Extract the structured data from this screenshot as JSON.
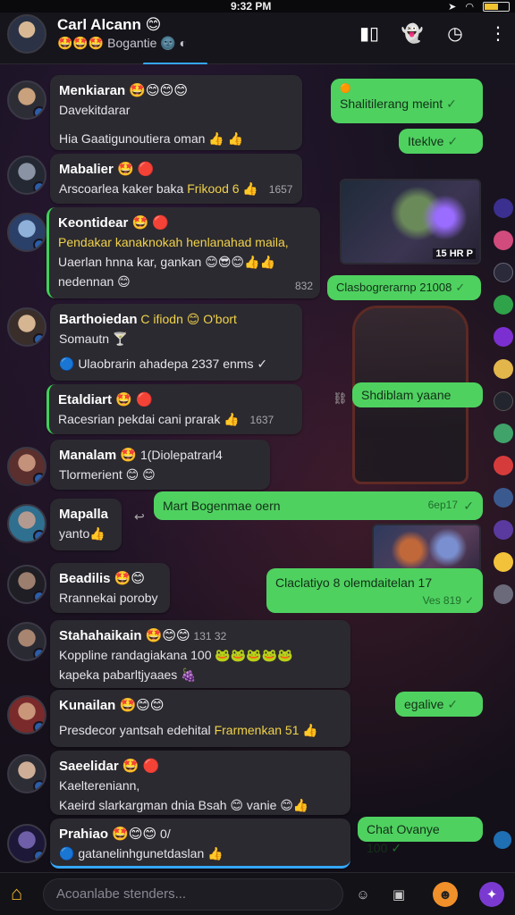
{
  "status": {
    "time": "9:32 PM"
  },
  "header": {
    "title": "Carl Alcann 😊",
    "subtitle": "🤩🤩🤩 Bogantie 🌚 ◐"
  },
  "composer": {
    "placeholder": "Acoanlabe stenders..."
  },
  "colors": {
    "accent": "#35a7ff",
    "outgoing": "#4fd160",
    "incoming": "#2b2a30",
    "highlight": "#f0d24a"
  },
  "messages": [
    {
      "name": "Menkiaran 🤩😊😊😊",
      "lines": [
        "Davekitdarar",
        "Hia Gaatigunoutiera oman 👍 👍"
      ]
    },
    {
      "name": "Mabalier 🤩 🔴",
      "lines": [
        "Arscoarlea kaker baka"
      ],
      "hl": "Frikood 6 👍",
      "meta": "1657"
    },
    {
      "name": "Keontidear 🤩 🔴",
      "hl": "Pendakar kanaknokah henlanahad maila,",
      "lines": [
        "Uaerlan hnna kar, gankan 😊😎😊👍👍",
        "nedennan 😊"
      ],
      "meta": "832"
    },
    {
      "name": "Barthoiedan",
      "nameTail": "C ifiodn 😊 O'bort",
      "lines": [
        "Somautn 🍸",
        "🔵 Ulaobrarin ahadepa 2337 enms ✓"
      ]
    },
    {
      "name": "Etaldiart 🤩 🔴",
      "lines": [
        "Racesrian pekdai cani prarak 👍"
      ],
      "meta": "1637"
    },
    {
      "name": "Manalam 🤩",
      "nameTail": "1(Diolepatrarl4",
      "lines": [
        "Tlormerient 😊 😊"
      ]
    },
    {
      "name": "Mapalla",
      "lines": [
        "yanto👍"
      ]
    },
    {
      "name": "Beadilis 🤩😊",
      "lines": [
        "Rrannekai poroby"
      ]
    },
    {
      "name": "Stahahaikain 🤩😊😊",
      "nameTail": "131 32",
      "lines": [
        "Koppline randagiakana 100 🐸🐸🐸🐸🐸",
        "kapeka pabarltjyaaes 🍇"
      ]
    },
    {
      "name": "Kunailan 🤩😊😊",
      "lines": [
        "Presdecor yantsah edehital"
      ],
      "hl": "Frarmenkan 51 👍"
    },
    {
      "name": "Saeelidar 🤩 🔴",
      "lines": [
        "Kaeltereniann,",
        "Kaeird slarkargman dnia Bsah 😊 vanie 😊👍"
      ]
    },
    {
      "name": "Prahiao 🤩😊😊",
      "nameTail": "0/",
      "lines": [
        "🔵 gatanelinhgunetdaslan 👍"
      ]
    }
  ],
  "outgoing": [
    {
      "text": "Shalitilerang meint",
      "top": "🟠"
    },
    {
      "text": "Iteklve"
    },
    {
      "text": "Clasbogrerarnp 21008"
    },
    {
      "text": "Shdiblam yaane"
    },
    {
      "text": "Mart Bogenmae oern",
      "meta": "6ep17"
    },
    {
      "text": "Claclatiyo 8 olemdaitelan 17",
      "meta": "Ves 819"
    },
    {
      "text": "egalive"
    },
    {
      "text": "Chat Ovanye 100"
    }
  ],
  "image_labels": {
    "game1": "15 HR P"
  }
}
